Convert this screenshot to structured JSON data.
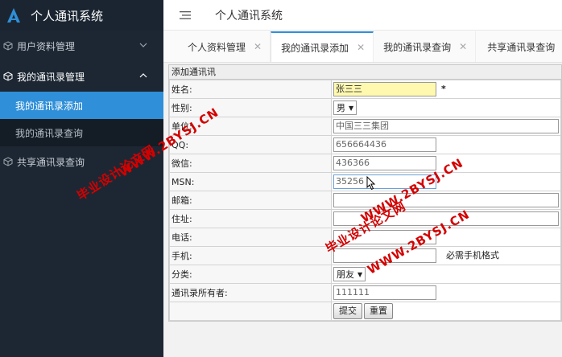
{
  "app": {
    "title": "个人通讯系统"
  },
  "sidebar": {
    "items": [
      {
        "label": "用户资料管理"
      },
      {
        "label": "我的通讯录管理"
      },
      {
        "label": "我的通讯录添加"
      },
      {
        "label": "我的通讯录查询"
      },
      {
        "label": "共享通讯录查询"
      }
    ]
  },
  "header": {
    "title": "个人通讯系统"
  },
  "tabs": [
    {
      "label": "个人资料管理"
    },
    {
      "label": "我的通讯录添加"
    },
    {
      "label": "我的通讯录查询"
    },
    {
      "label": "共享通讯录查询"
    }
  ],
  "form": {
    "caption": "添加通讯讯",
    "rows": {
      "name": {
        "label": "姓名:",
        "value": "张三三",
        "required": "*"
      },
      "gender": {
        "label": "性别:",
        "value": "男"
      },
      "company": {
        "label": "单位:",
        "value": "中国三三集团"
      },
      "qq": {
        "label": "QQ:",
        "value": "656664436"
      },
      "wechat": {
        "label": "微信:",
        "value": "436366"
      },
      "msn": {
        "label": "MSN:",
        "value": "35256"
      },
      "email": {
        "label": "邮箱:",
        "value": ""
      },
      "address": {
        "label": "住址:",
        "value": ""
      },
      "phone": {
        "label": "电话:",
        "value": ""
      },
      "mobile": {
        "label": "手机:",
        "value": "",
        "hint": "必需手机格式"
      },
      "category": {
        "label": "分类:",
        "value": "朋友"
      },
      "owner": {
        "label": "通讯录所有者:",
        "value": "111111"
      }
    },
    "submit_label": "提交",
    "reset_label": "重置"
  },
  "watermarks": [
    {
      "text": "WWW.2BYSJ.CN"
    },
    {
      "text": "毕业设计论文网"
    },
    {
      "text": "WWW.2BYSJ.CN"
    },
    {
      "text": "毕业设计论文网"
    },
    {
      "text": "WWW.2BYSJ.CN"
    }
  ],
  "colors": {
    "sidebar_bg": "#1d2733",
    "accent": "#2f8fd8",
    "watermark": "#d40000"
  }
}
